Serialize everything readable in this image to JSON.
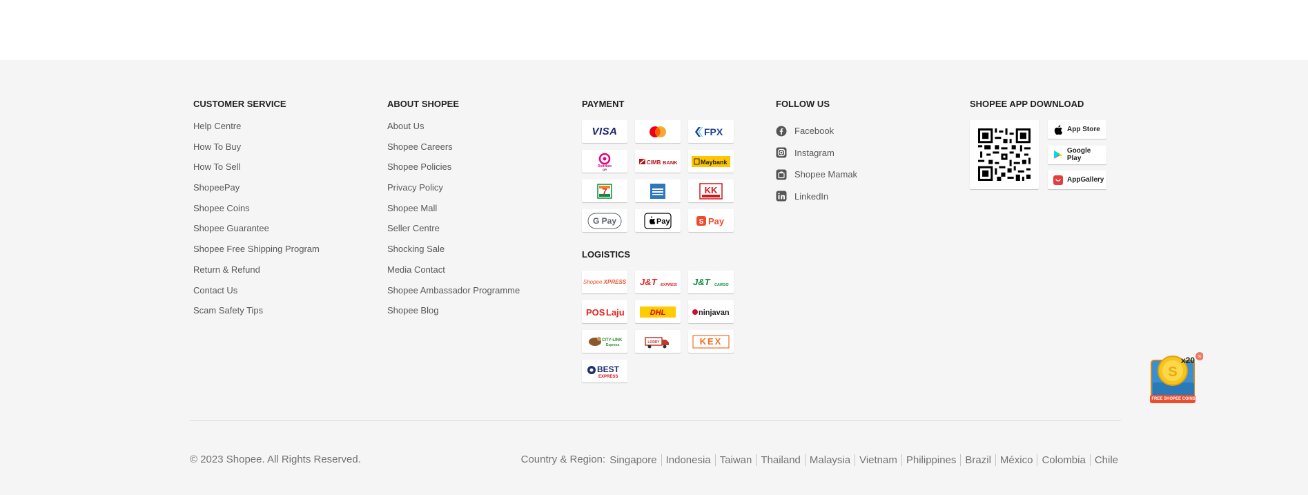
{
  "customer_service": {
    "title": "CUSTOMER SERVICE",
    "links": [
      "Help Centre",
      "How To Buy",
      "How To Sell",
      "ShopeePay",
      "Shopee Coins",
      "Shopee Guarantee",
      "Shopee Free Shipping Program",
      "Return & Refund",
      "Contact Us",
      "Scam Safety Tips"
    ]
  },
  "about_shopee": {
    "title": "ABOUT SHOPEE",
    "links": [
      "About Us",
      "Shopee Careers",
      "Shopee Policies",
      "Privacy Policy",
      "Shopee Mall",
      "Seller Centre",
      "Shocking Sale",
      "Media Contact",
      "Shopee Ambassador Programme",
      "Shopee Blog"
    ]
  },
  "payment": {
    "title": "PAYMENT",
    "logos": [
      {
        "name": "visa-logo",
        "text": "VISA",
        "color": "#1a1f71"
      },
      {
        "name": "mastercard-logo",
        "text": "",
        "color": "#eb001b"
      },
      {
        "name": "fpx-logo",
        "text": "FPX",
        "color": "#1c3f94"
      },
      {
        "name": "duitnow-logo",
        "text": "DuitNow QR",
        "color": "#e6007e"
      },
      {
        "name": "cimb-logo",
        "text": "CIMB BANK",
        "color": "#b5121b"
      },
      {
        "name": "maybank-logo",
        "text": "Maybank",
        "color": "#222222"
      },
      {
        "name": "seven-eleven-logo",
        "text": "7",
        "color": "#e2231a"
      },
      {
        "name": "amex-logo",
        "text": "AMEX",
        "color": "#2e77bc"
      },
      {
        "name": "kk-mart-logo",
        "text": "KK",
        "color": "#d7141a"
      },
      {
        "name": "google-pay-logo",
        "text": "G Pay",
        "color": "#5f6368"
      },
      {
        "name": "apple-pay-logo",
        "text": "Pay",
        "color": "#000000"
      },
      {
        "name": "shopee-pay-logo",
        "text": "Pay",
        "color": "#ee4d2d"
      }
    ]
  },
  "logistics": {
    "title": "LOGISTICS",
    "logos": [
      {
        "name": "shopee-xpress-logo",
        "text": "Shopee Xpress",
        "color": "#ee4d2d"
      },
      {
        "name": "jt-express-logo",
        "text": "J&T EXPRESS",
        "color": "#e3262a"
      },
      {
        "name": "jt-cargo-logo",
        "text": "J&T CARGO",
        "color": "#0c8a3e"
      },
      {
        "name": "poslaju-logo",
        "text": "Laju",
        "color": "#e1251b"
      },
      {
        "name": "dhl-logo",
        "text": "DHL",
        "color": "#d40511"
      },
      {
        "name": "ninjavan-logo",
        "text": "ninjavan",
        "color": "#c8102e"
      },
      {
        "name": "citylink-logo",
        "text": "CITY-LINK",
        "color": "#2e8b2e"
      },
      {
        "name": "lorry-logo",
        "text": "THE LORRY",
        "color": "#c0392b"
      },
      {
        "name": "kex-logo",
        "text": "KEX",
        "color": "#f36f21"
      },
      {
        "name": "best-express-logo",
        "text": "BEST",
        "color": "#1c2f6e"
      }
    ]
  },
  "follow_us": {
    "title": "FOLLOW US",
    "items": [
      {
        "label": "Facebook",
        "icon": "facebook-icon"
      },
      {
        "label": "Instagram",
        "icon": "instagram-icon"
      },
      {
        "label": "Shopee Mamak",
        "icon": "shopee-mamak-icon"
      },
      {
        "label": "LinkedIn",
        "icon": "linkedin-icon"
      }
    ]
  },
  "app_download": {
    "title": "SHOPEE APP DOWNLOAD",
    "stores": [
      {
        "label": "App Store",
        "icon": "apple-icon"
      },
      {
        "label": "Google Play",
        "icon": "google-play-icon"
      },
      {
        "label": "AppGallery",
        "icon": "appgallery-icon"
      }
    ]
  },
  "bottom": {
    "copyright": "© 2023 Shopee. All Rights Reserved.",
    "region_label": "Country & Region:",
    "countries": [
      "Singapore",
      "Indonesia",
      "Taiwan",
      "Thailand",
      "Malaysia",
      "Vietnam",
      "Philippines",
      "Brazil",
      "México",
      "Colombia",
      "Chile"
    ]
  },
  "coin_widget": {
    "multiplier": "x20",
    "caption": "FREE SHOPEE COINS"
  },
  "colors": {
    "brand": "#ee4d2d",
    "footer_bg": "#f5f5f5"
  }
}
